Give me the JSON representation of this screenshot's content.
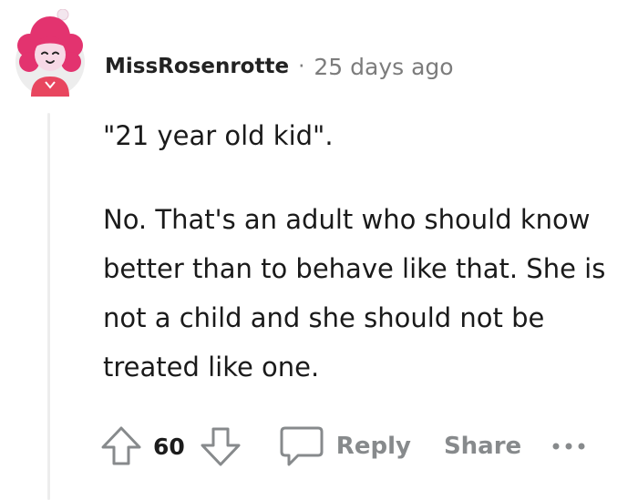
{
  "comment": {
    "username": "MissRosenrotte",
    "separator": "·",
    "timestamp": "25 days ago",
    "paragraphs": [
      "\"21 year old kid\".",
      "No. That's an adult who should know better than to behave like that. She is not a child and she should not be treated like one."
    ]
  },
  "actions": {
    "upvote_icon": "arrow-up-icon",
    "vote_count": "60",
    "downvote_icon": "arrow-down-icon",
    "reply_icon": "chat-bubble-icon",
    "reply_label": "Reply",
    "share_label": "Share",
    "more_icon": "ellipsis-icon"
  },
  "colors": {
    "muted": "#878a8c",
    "avatar_hair": "#e3336f",
    "avatar_shirt": "#e8465f",
    "avatar_background": "#ededed"
  }
}
